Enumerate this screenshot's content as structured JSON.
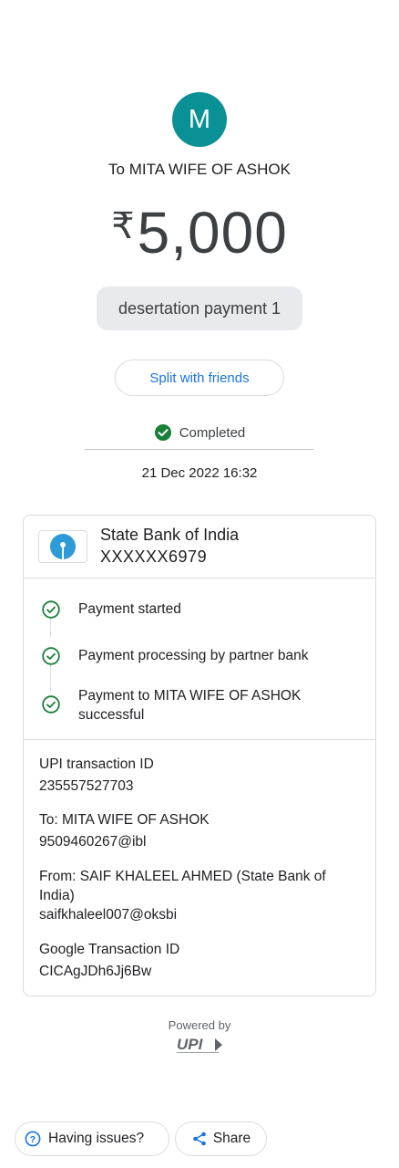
{
  "header": {
    "avatar_letter": "M",
    "recipient_line": "To MITA WIFE OF ASHOK",
    "currency_symbol": "₹",
    "amount": "5,000",
    "note": "desertation payment 1",
    "split_label": "Split with friends",
    "status": "Completed",
    "datetime": "21 Dec 2022 16:32"
  },
  "bank": {
    "name": "State Bank of India",
    "account": "XXXXXX6979"
  },
  "steps": [
    {
      "label": "Payment started"
    },
    {
      "label": "Payment processing by partner bank"
    },
    {
      "label": "Payment to MITA WIFE OF ASHOK successful"
    }
  ],
  "details": {
    "upi_label": "UPI transaction ID",
    "upi_value": "235557527703",
    "to_label": "To: MITA WIFE OF ASHOK",
    "to_value": "9509460267@ibl",
    "from_label": "From: SAIF  KHALEEL AHMED (State Bank of India)",
    "from_value": "saifkhaleel007@oksbi",
    "google_label": "Google Transaction ID",
    "google_value": "CICAgJDh6Jj6Bw"
  },
  "footer": {
    "powered_by": "Powered by",
    "upi_logo_text": "UPI",
    "issues_label": "Having issues?",
    "share_label": "Share"
  },
  "colors": {
    "avatar": "#0a9196",
    "success": "#188038",
    "link": "#1a73e8"
  }
}
